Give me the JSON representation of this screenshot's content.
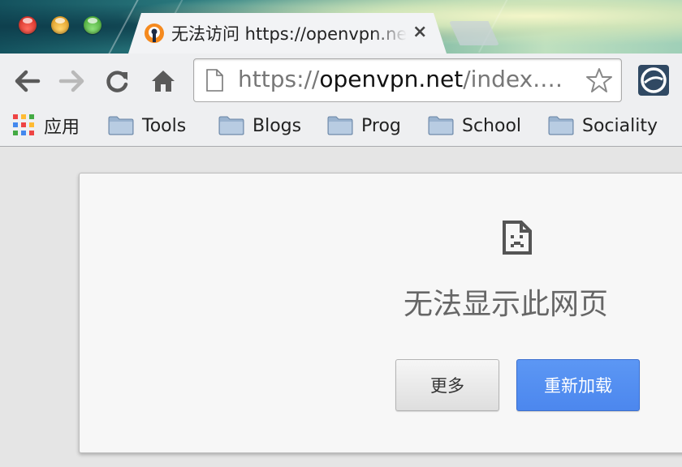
{
  "window": {
    "controls": [
      "close",
      "minimize",
      "maximize"
    ]
  },
  "tab": {
    "title": "无法访问 https://openvpn.net",
    "favicon": "openvpn-icon",
    "close_label": "×"
  },
  "toolbar": {
    "back": "back-arrow-icon",
    "forward": "forward-arrow-icon",
    "reload": "reload-icon",
    "home": "home-icon",
    "url_scheme": "https://",
    "url_host": "openvpn.net",
    "url_path": "/index.…",
    "extension": "openvpn-extension-icon"
  },
  "bookmarks": [
    {
      "label": "应用",
      "icon": "apps-grid-icon"
    },
    {
      "label": "Tools",
      "icon": "folder-icon"
    },
    {
      "label": "Blogs",
      "icon": "folder-icon"
    },
    {
      "label": "Prog",
      "icon": "folder-icon"
    },
    {
      "label": "School",
      "icon": "folder-icon"
    },
    {
      "label": "Sociality",
      "icon": "folder-icon"
    }
  ],
  "error": {
    "icon": "sad-page-icon",
    "title": "无法显示此网页",
    "more_button": "更多",
    "reload_button": "重新加载"
  },
  "colors": {
    "reload_button": "#4d8af0",
    "tab_background": "#f2f3f5",
    "toolbar": "#eeeff1"
  }
}
